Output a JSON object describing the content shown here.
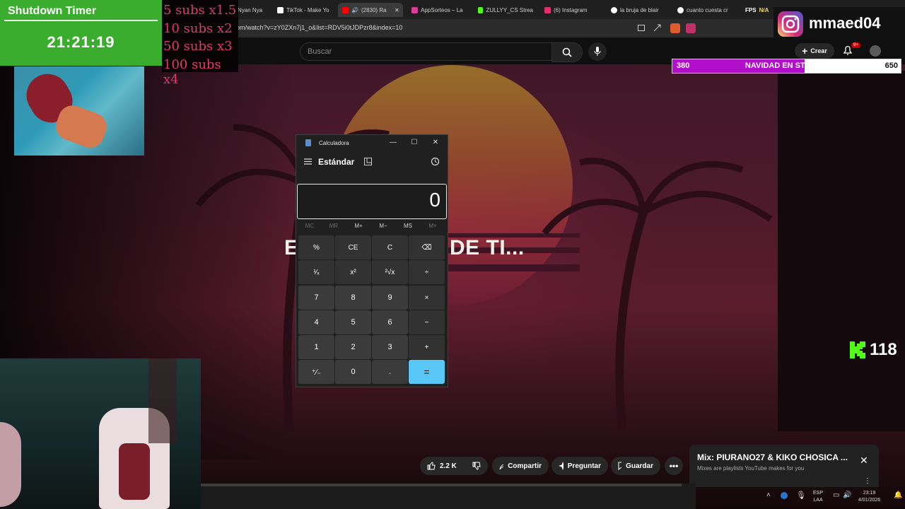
{
  "browser": {
    "tabs": [
      {
        "label": "Nyan Nya",
        "color": "#b0b0b0"
      },
      {
        "label": "TikTok - Make Yo",
        "color": "#ffffff"
      },
      {
        "label": "(2830) Ra",
        "color": "#ff0000"
      },
      {
        "label": "AppSorteos – La",
        "color": "#d93c9a"
      },
      {
        "label": "ZULLYY_CS Strea",
        "color": "#53fc18"
      },
      {
        "label": "(6) Instagram",
        "color": "#e1306c"
      },
      {
        "label": "la bruja de blair",
        "color": "#ffffff"
      },
      {
        "label": "cuanto cuesta cr",
        "color": "#ffffff"
      }
    ],
    "url": "om/watch?v=zY0ZXn7j1_o&list=RDV5i0tJDPzr8&index=10",
    "fps_label": "FPS",
    "fps_value": "N/A"
  },
  "youtube": {
    "search_placeholder": "Buscar",
    "create_label": "Crear",
    "notification_badge": "9+"
  },
  "video": {
    "lyric": "E          STA TO’ DE TI..."
  },
  "overlay": {
    "timer_title": "Shutdown Timer",
    "timer_value": "21:21:19",
    "subs": [
      "5 subs x1.5",
      "10 subs x2",
      "50 subs x3",
      "100 subs x4"
    ],
    "instagram_handle": "mmaed04",
    "goal": {
      "current": "380",
      "title": "NAVIDAD EN STREAM",
      "target": "650",
      "fraction": 0.58
    },
    "kick_viewers": "118"
  },
  "calculator": {
    "window_title": "Calculadora",
    "mode": "Estándar",
    "display": "0",
    "memory": [
      {
        "label": "MC",
        "enabled": false
      },
      {
        "label": "MR",
        "enabled": false
      },
      {
        "label": "M+",
        "enabled": true
      },
      {
        "label": "M−",
        "enabled": true
      },
      {
        "label": "MS",
        "enabled": true
      },
      {
        "label": "M˅",
        "enabled": false
      }
    ],
    "keys": [
      [
        "%",
        "CE",
        "C",
        "⌫"
      ],
      [
        "¹⁄ₓ",
        "x²",
        "²√x",
        "÷"
      ],
      [
        "7",
        "8",
        "9",
        "×"
      ],
      [
        "4",
        "5",
        "6",
        "−"
      ],
      [
        "1",
        "2",
        "3",
        "+"
      ],
      [
        "⁺⁄₋",
        "0",
        ".",
        "="
      ]
    ]
  },
  "actions": {
    "likes": "2.2 K",
    "share": "Compartir",
    "ask": "Preguntar",
    "save": "Guardar"
  },
  "mix": {
    "title": "Mix: PIURANO27 & KIKO CHOSICA ...",
    "subtitle": "Mixes are playlists YouTube makes for you"
  },
  "taskbar": {
    "lang_top": "ESP",
    "lang_bottom": "LAA",
    "time": "23:19",
    "date": "4/01/2026"
  }
}
